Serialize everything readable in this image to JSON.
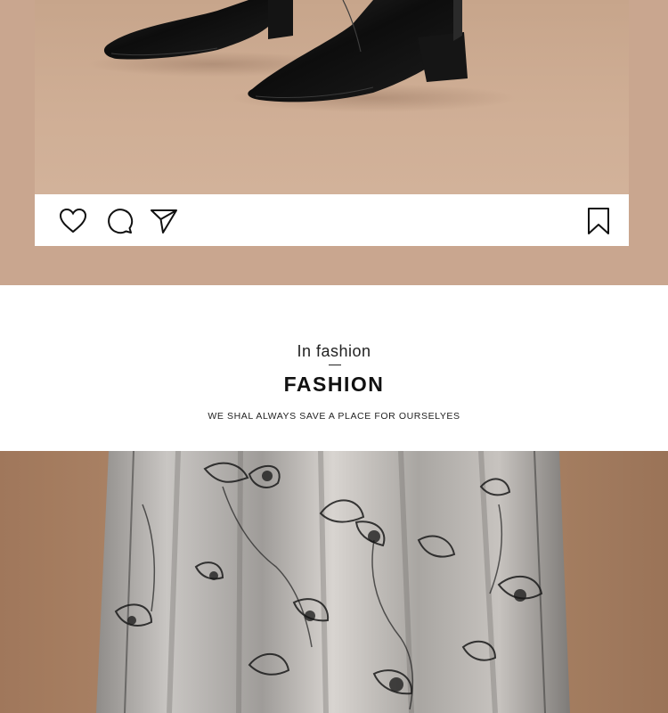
{
  "post_actions": {
    "like_icon": "heart-outline",
    "comment_icon": "speech-bubble-outline",
    "share_icon": "paper-plane-outline",
    "save_icon": "bookmark-outline"
  },
  "section": {
    "subtitle": "In fashion",
    "title": "FASHION",
    "tagline": "WE SHAL ALWAYS SAVE A PLACE FOR OURSELYES"
  },
  "colors": {
    "backdrop": "#c9a68f",
    "boot_leather": "#111111",
    "skirt_tulle": "#b9b7b4"
  }
}
